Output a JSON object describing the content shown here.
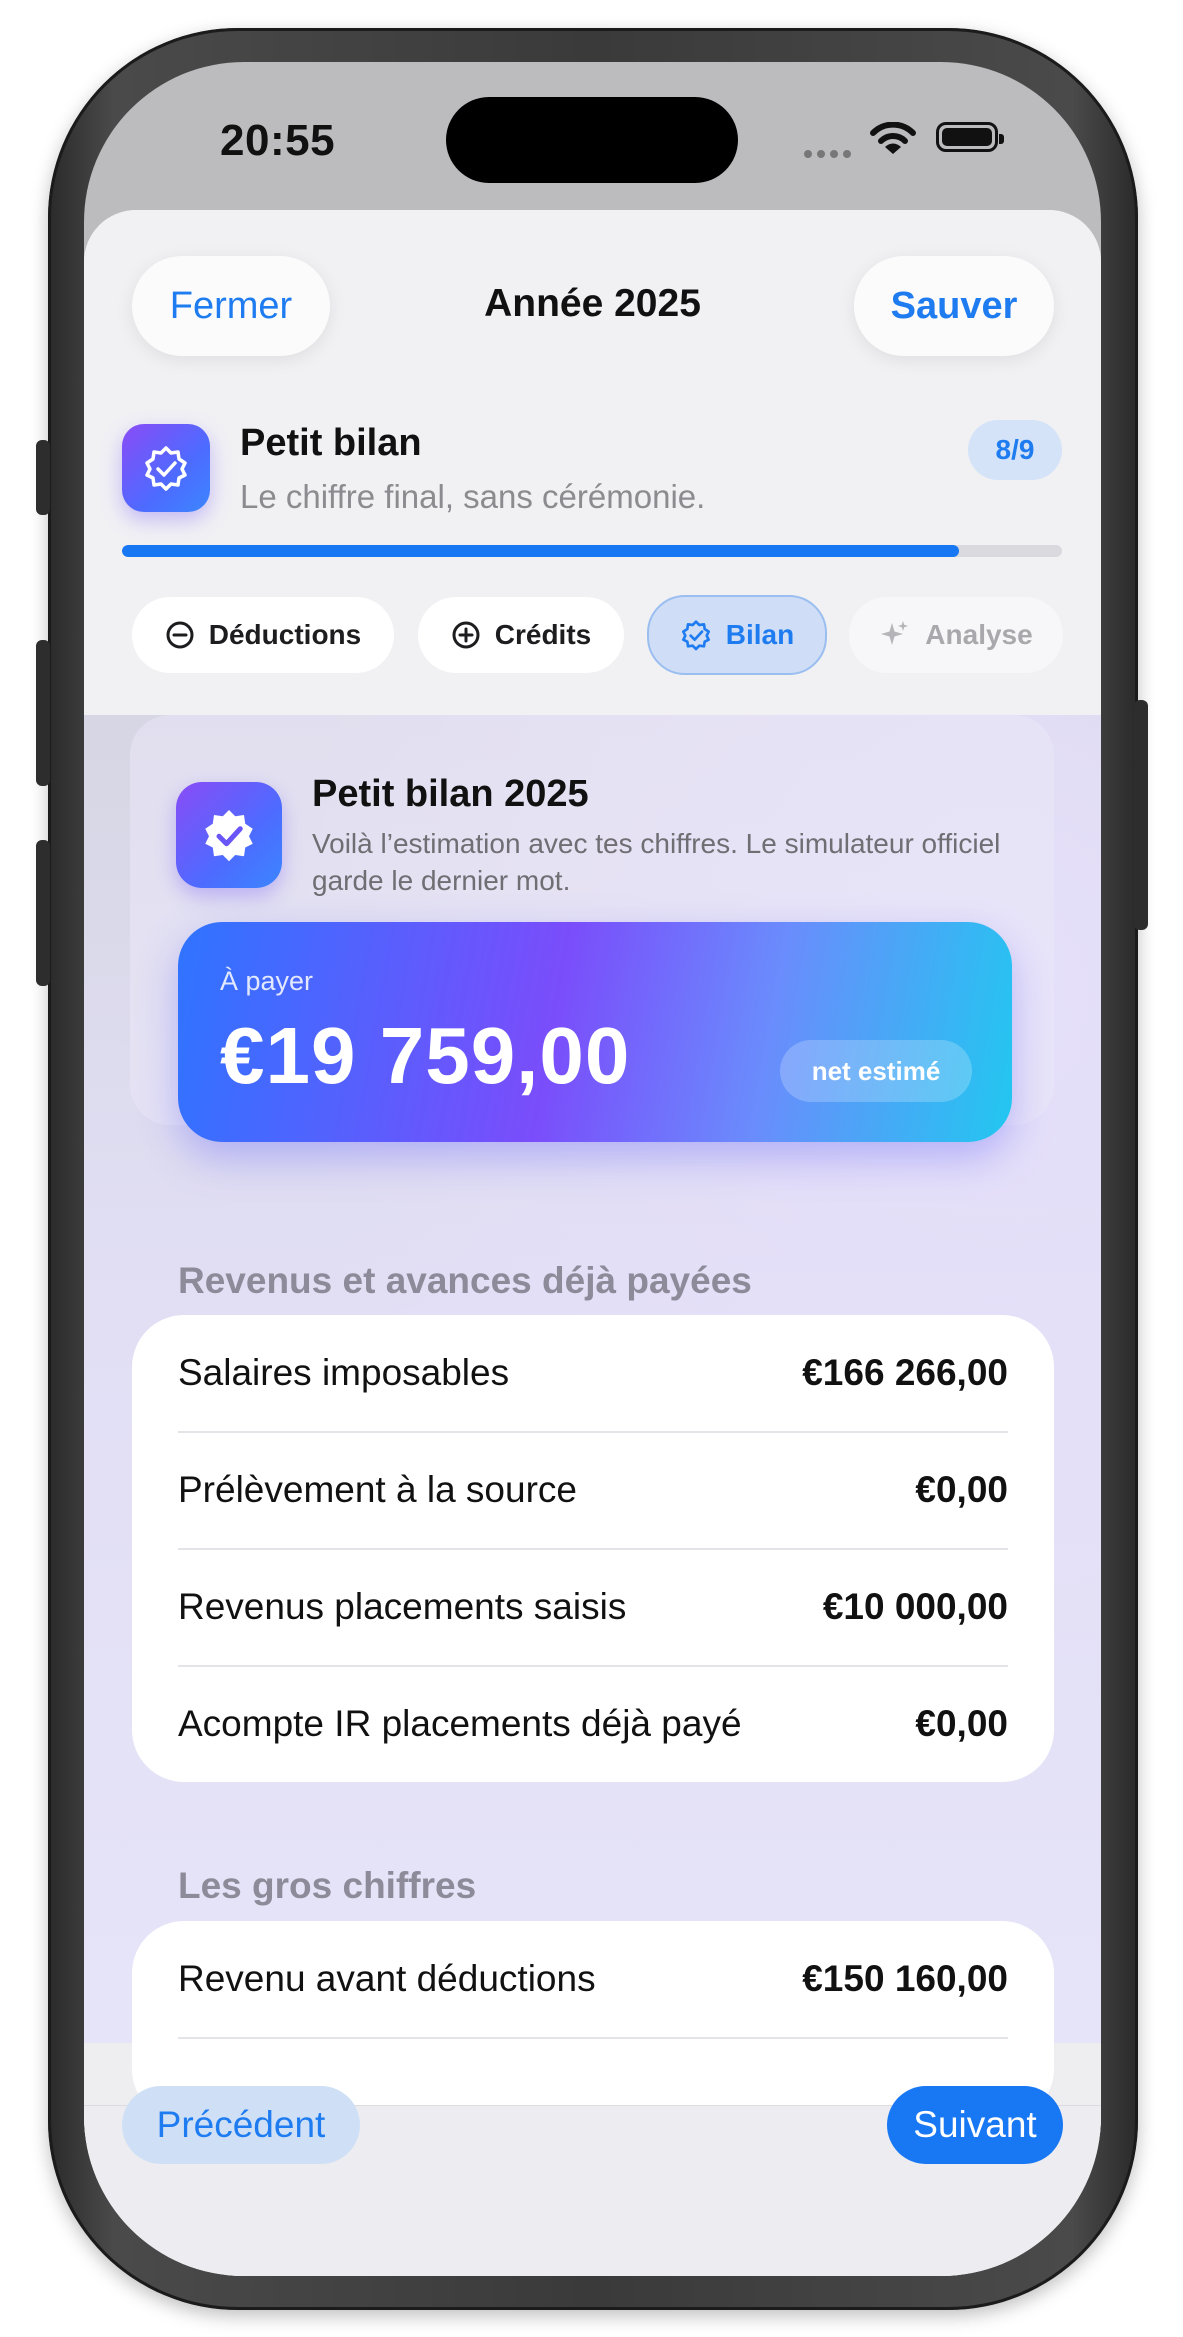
{
  "status_bar": {
    "time": "20:55"
  },
  "header": {
    "close_label": "Fermer",
    "title": "Année 2025",
    "save_label": "Sauver"
  },
  "step": {
    "icon": "verified-badge-icon",
    "title": "Petit bilan",
    "subtitle": "Le chiffre final, sans cérémonie.",
    "counter": "8/9",
    "progress": 0.89
  },
  "tabs": [
    {
      "label": "Déductions",
      "icon": "minus-circle-icon",
      "state": "default"
    },
    {
      "label": "Crédits",
      "icon": "plus-circle-icon",
      "state": "default"
    },
    {
      "label": "Bilan",
      "icon": "verified-badge-icon",
      "state": "selected"
    },
    {
      "label": "Analyse",
      "icon": "sparkles-icon",
      "state": "disabled"
    }
  ],
  "summary": {
    "title": "Petit bilan 2025",
    "description": "Voilà l’estimation avec tes chiffres. Le simulateur officiel garde le dernier mot.",
    "pay_label": "À payer",
    "amount": "€19 759,00",
    "tag": "net estimé"
  },
  "sections": [
    {
      "title": "Revenus et avances déjà payées",
      "rows": [
        {
          "label": "Salaires imposables",
          "value": "€166 266,00"
        },
        {
          "label": "Prélèvement à la source",
          "value": "€0,00"
        },
        {
          "label": "Revenus placements saisis",
          "value": "€10 000,00"
        },
        {
          "label": "Acompte IR placements déjà payé",
          "value": "€0,00"
        }
      ]
    },
    {
      "title": "Les gros chiffres",
      "rows": [
        {
          "label": "Revenu avant déductions",
          "value": "€150 160,00"
        }
      ]
    }
  ],
  "footer": {
    "prev_label": "Précédent",
    "next_label": "Suivant"
  },
  "colors": {
    "accent": "#1877f2",
    "gradient_start": "#2f74ff",
    "gradient_mid": "#7a4dfb",
    "gradient_end": "#22c7f0"
  }
}
